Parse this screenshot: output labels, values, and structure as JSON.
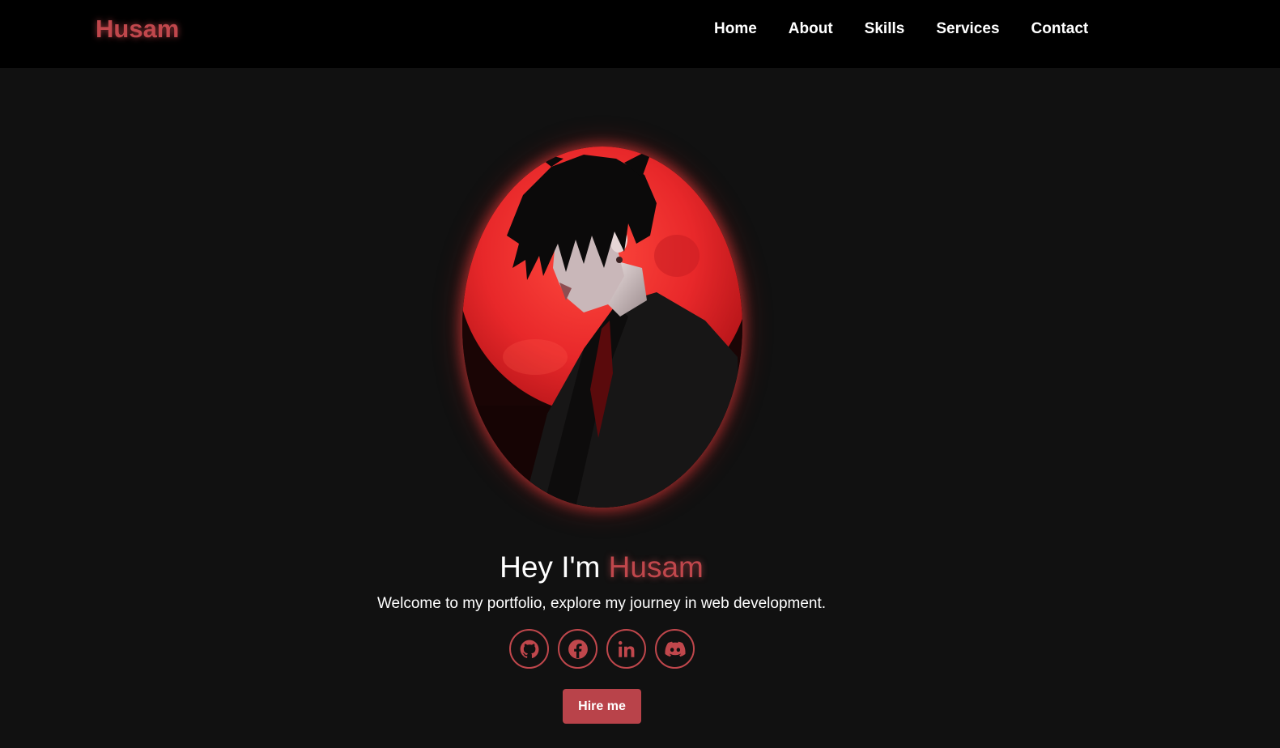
{
  "nav": {
    "logo": "Husam",
    "links": [
      {
        "label": "Home"
      },
      {
        "label": "About"
      },
      {
        "label": "Skills"
      },
      {
        "label": "Services"
      },
      {
        "label": "Contact"
      }
    ]
  },
  "hero": {
    "greeting_prefix": "Hey I'm ",
    "greeting_name": "Husam",
    "subtitle": "Welcome to my portfolio, explore my journey in web development.",
    "portrait_icon": "anime-portrait-red-moon",
    "socials": [
      {
        "icon": "github-icon"
      },
      {
        "icon": "facebook-icon"
      },
      {
        "icon": "linkedin-icon"
      },
      {
        "icon": "discord-icon"
      }
    ],
    "cta_label": "Hire me"
  },
  "colors": {
    "accent": "#c0474c",
    "background": "#111111",
    "navbar": "#000000",
    "button": "#b9434a"
  }
}
